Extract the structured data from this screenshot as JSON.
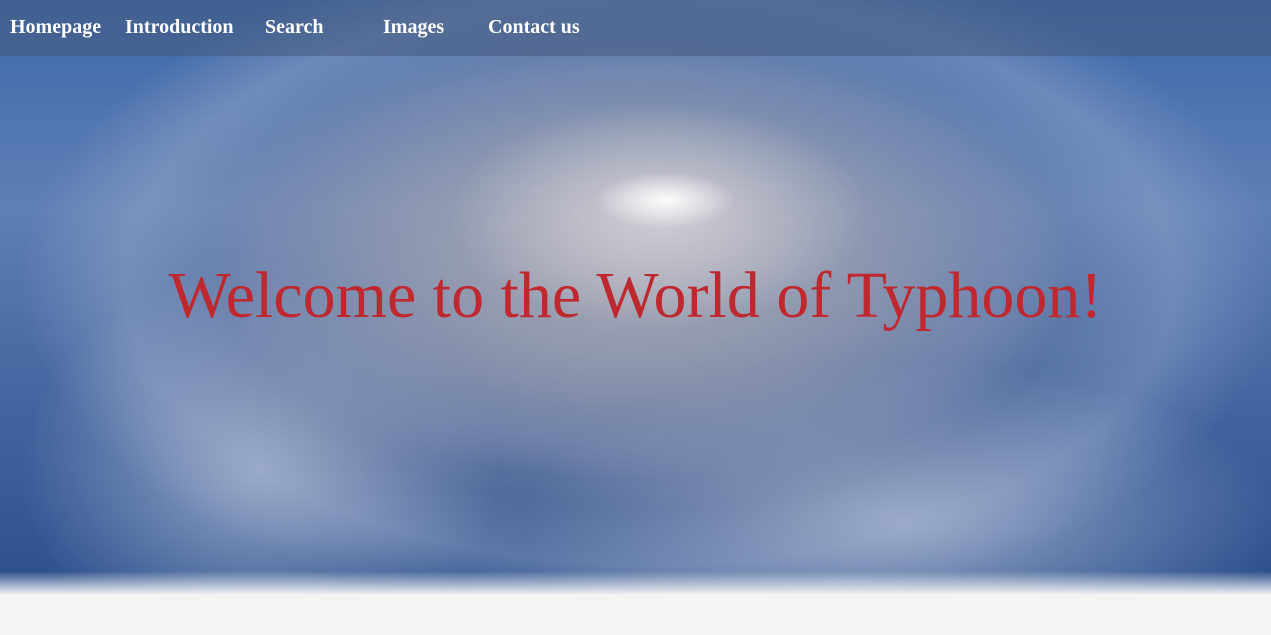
{
  "nav": {
    "items": [
      {
        "label": "Homepage"
      },
      {
        "label": "Introduction"
      },
      {
        "label": "Search"
      },
      {
        "label": "Images"
      },
      {
        "label": "Contact us"
      }
    ]
  },
  "hero": {
    "headline": "Welcome to the World of Typhoon!",
    "background_image": "typhoon-satellite-photo",
    "headline_color": "#c0282f"
  },
  "colors": {
    "nav_text": "#ffffff",
    "page_background": "#f4f4f5"
  }
}
